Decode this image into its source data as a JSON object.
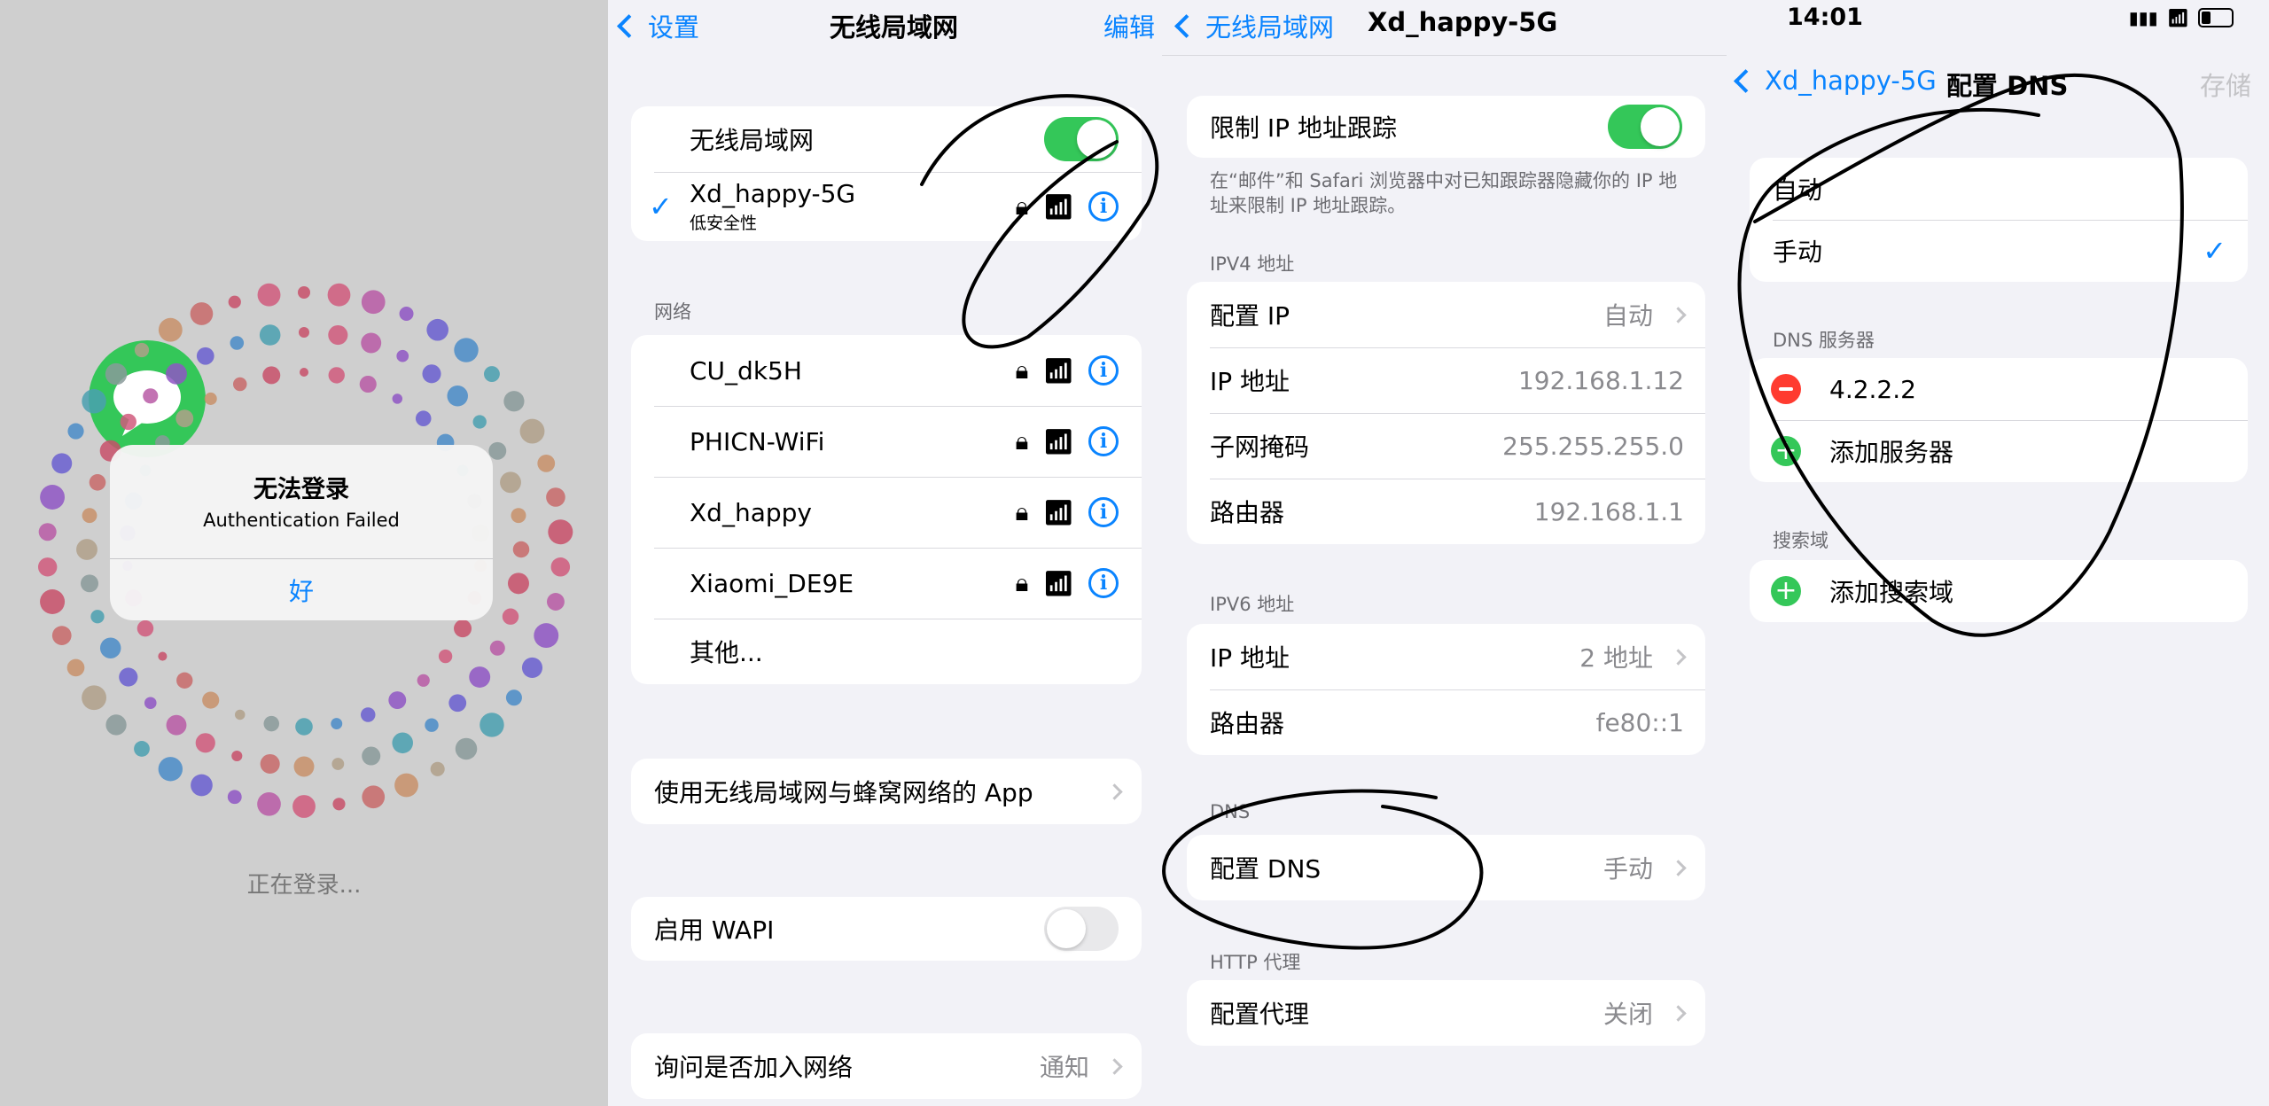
{
  "panel1": {
    "alert_title": "无法登录",
    "alert_message": "Authentication Failed",
    "alert_ok": "好",
    "status": "正在登录..."
  },
  "panel2": {
    "back": "设置",
    "title": "无线局域网",
    "edit": "编辑",
    "wifi_label": "无线局域网",
    "wifi_on": true,
    "connected": {
      "name": "Xd_happy-5G",
      "sub": "低安全性"
    },
    "networks_header": "网络",
    "networks": [
      "CU_dk5H",
      "PHICN-WiFi",
      "Xd_happy",
      "Xiaomi_DE9E"
    ],
    "other": "其他...",
    "apps_row": "使用无线局域网与蜂窝网络的 App",
    "wapi": "启用 WAPI",
    "wapi_on": false,
    "ask_join": "询问是否加入网络",
    "ask_join_value": "通知"
  },
  "panel3": {
    "back": "无线局域网",
    "title": "Xd_happy-5G",
    "limit_tracking": "限制 IP 地址跟踪",
    "limit_tracking_on": true,
    "note": "在“邮件”和 Safari 浏览器中对已知跟踪器隐藏你的 IP 地址来限制 IP 地址跟踪。",
    "ipv4_header": "IPV4 地址",
    "ipv4": [
      {
        "label": "配置 IP",
        "value": "自动",
        "chevron": true
      },
      {
        "label": "IP 地址",
        "value": "192.168.1.12",
        "chevron": false
      },
      {
        "label": "子网掩码",
        "value": "255.255.255.0",
        "chevron": false
      },
      {
        "label": "路由器",
        "value": "192.168.1.1",
        "chevron": false
      }
    ],
    "ipv6_header": "IPV6 地址",
    "ipv6": [
      {
        "label": "IP 地址",
        "value": "2 地址",
        "chevron": true
      },
      {
        "label": "路由器",
        "value": "fe80::1",
        "chevron": false
      }
    ],
    "dns_header": "DNS",
    "dns_label": "配置 DNS",
    "dns_value": "手动",
    "proxy_header": "HTTP 代理",
    "proxy_label": "配置代理",
    "proxy_value": "关闭"
  },
  "panel4": {
    "time": "14:01",
    "back": "Xd_happy-5G",
    "title": "配置 DNS",
    "save": "存储",
    "mode_auto": "自动",
    "mode_manual": "手动",
    "selected_mode": "手动",
    "dns_header": "DNS 服务器",
    "dns_server": "4.2.2.2",
    "add_server": "添加服务器",
    "search_header": "搜索域",
    "add_search": "添加搜索域"
  },
  "colors": {
    "accent": "#0a84ff",
    "toggle_on": "#34c759",
    "delete": "#ff3b30",
    "add": "#34c759"
  }
}
